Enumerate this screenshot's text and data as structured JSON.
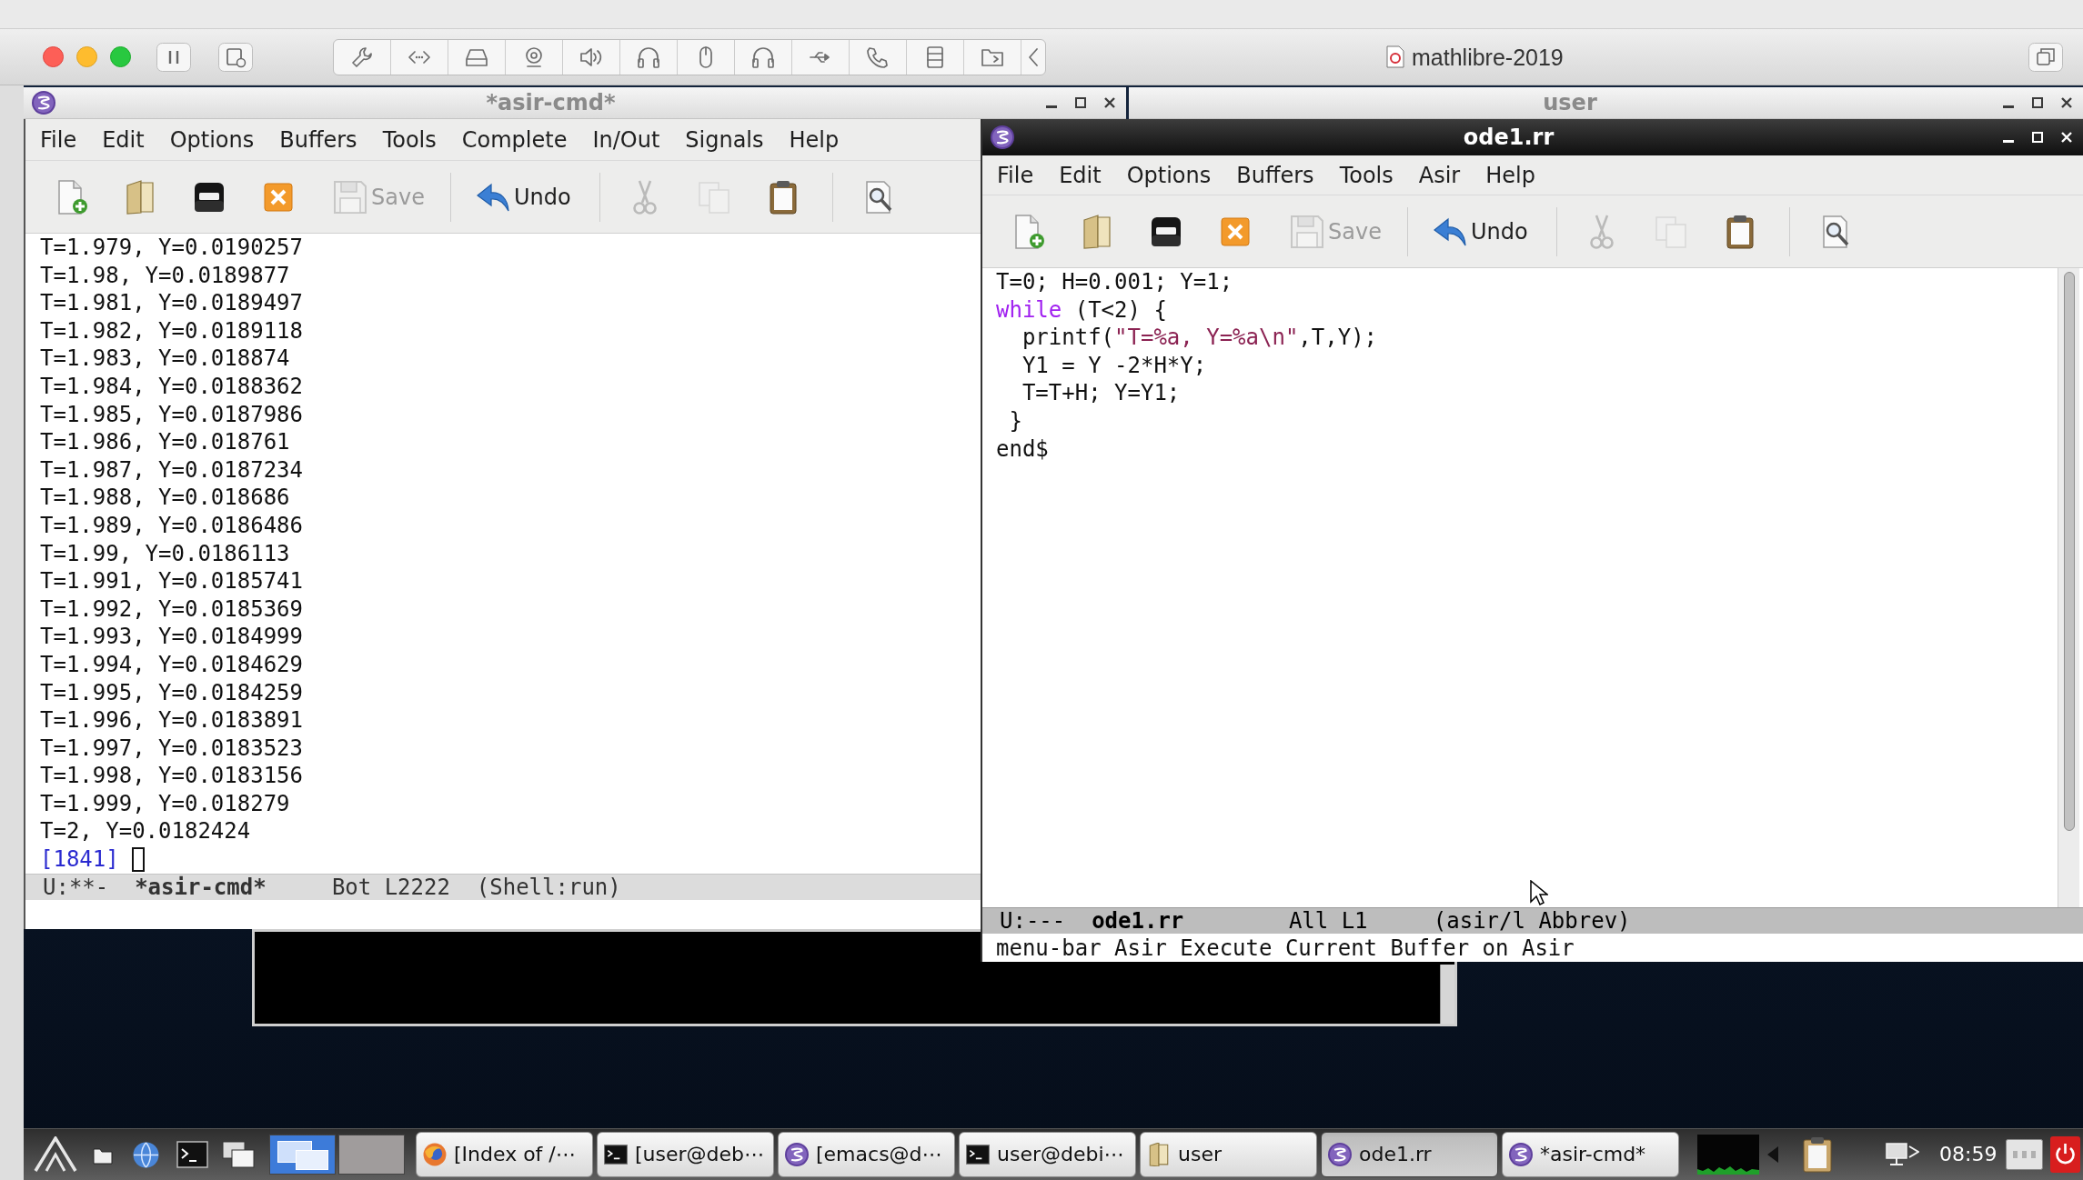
{
  "host_window": {
    "title": "mathlibre-2019"
  },
  "shell_window": {
    "title": "*asir-cmd*",
    "active": false,
    "menu": [
      "File",
      "Edit",
      "Options",
      "Buffers",
      "Tools",
      "Complete",
      "In/Out",
      "Signals",
      "Help"
    ],
    "toolbar": {
      "save": {
        "label": "Save",
        "disabled": true
      },
      "undo": {
        "label": "Undo",
        "disabled": false
      },
      "cut": {
        "disabled": true
      },
      "copy": {
        "disabled": true
      }
    },
    "lines": [
      "T=1.979, Y=0.0190257",
      "T=1.98, Y=0.0189877",
      "T=1.981, Y=0.0189497",
      "T=1.982, Y=0.0189118",
      "T=1.983, Y=0.018874",
      "T=1.984, Y=0.0188362",
      "T=1.985, Y=0.0187986",
      "T=1.986, Y=0.018761",
      "T=1.987, Y=0.0187234",
      "T=1.988, Y=0.018686",
      "T=1.989, Y=0.0186486",
      "T=1.99, Y=0.0186113",
      "T=1.991, Y=0.0185741",
      "T=1.992, Y=0.0185369",
      "T=1.993, Y=0.0184999",
      "T=1.994, Y=0.0184629",
      "T=1.995, Y=0.0184259",
      "T=1.996, Y=0.0183891",
      "T=1.997, Y=0.0183523",
      "T=1.998, Y=0.0183156",
      "T=1.999, Y=0.018279",
      "T=2, Y=0.0182424"
    ],
    "prompt": "[1841]",
    "mode_line": {
      "status": "U:**-",
      "buffer": "*asir-cmd*",
      "position": "Bot L2222",
      "modes": "(Shell:run)"
    }
  },
  "background_window": {
    "title": "user",
    "active": false
  },
  "editor_window": {
    "title": "ode1.rr",
    "active": true,
    "menu": [
      "File",
      "Edit",
      "Options",
      "Buffers",
      "Tools",
      "Asir",
      "Help"
    ],
    "toolbar": {
      "save": {
        "label": "Save",
        "disabled": true
      },
      "undo": {
        "label": "Undo",
        "disabled": false
      },
      "cut": {
        "disabled": true
      },
      "copy": {
        "disabled": true
      }
    },
    "code": [
      {
        "segments": [
          {
            "kind": "plain",
            "text": "T=0; H=0.001; Y=1;"
          }
        ]
      },
      {
        "segments": [
          {
            "kind": "keyword",
            "text": "while"
          },
          {
            "kind": "plain",
            "text": " (T<2) {"
          }
        ]
      },
      {
        "segments": [
          {
            "kind": "plain",
            "text": "  printf("
          },
          {
            "kind": "string",
            "text": "\"T=%a, Y=%a\\n\""
          },
          {
            "kind": "plain",
            "text": ",T,Y);"
          }
        ]
      },
      {
        "segments": [
          {
            "kind": "plain",
            "text": "  Y1 = Y -2*H*Y;"
          }
        ]
      },
      {
        "segments": [
          {
            "kind": "plain",
            "text": "  T=T+H; Y=Y1;"
          }
        ]
      },
      {
        "segments": [
          {
            "kind": "plain",
            "text": " }"
          }
        ]
      },
      {
        "segments": [
          {
            "kind": "plain",
            "text": "end$"
          }
        ]
      }
    ],
    "mode_line": {
      "status": "U:---",
      "buffer": "ode1.rr",
      "position": "All L1",
      "modes": "(asir/l Abbrev)"
    },
    "echo": "menu-bar Asir Execute Current Buffer on Asir"
  },
  "taskbar": {
    "workspaces": [
      {
        "selected": true
      },
      {
        "selected": false
      }
    ],
    "tasks": [
      {
        "label": "[Index of /⋯",
        "kind": "browser",
        "selected": false
      },
      {
        "label": "[user@deb⋯",
        "kind": "terminal",
        "selected": false
      },
      {
        "label": "[emacs@d⋯",
        "kind": "emacs",
        "selected": false
      },
      {
        "label": "user@debi⋯",
        "kind": "terminal",
        "selected": false
      },
      {
        "label": "user",
        "kind": "folder",
        "selected": false
      },
      {
        "label": "ode1.rr",
        "kind": "emacs",
        "selected": true
      },
      {
        "label": "*asir-cmd*",
        "kind": "emacs",
        "selected": false
      }
    ],
    "clock": "08:59"
  }
}
